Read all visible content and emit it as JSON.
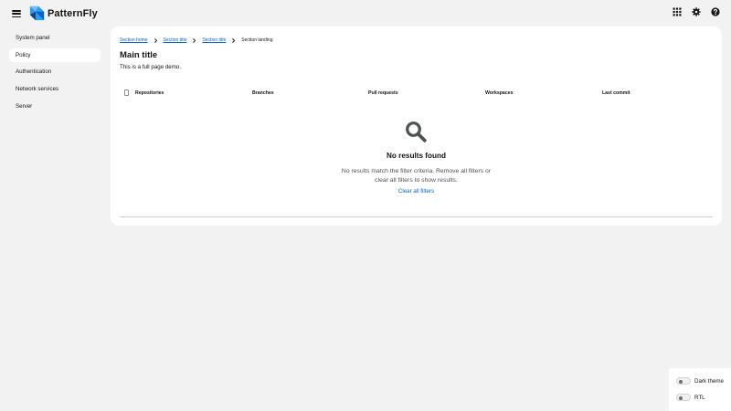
{
  "app": {
    "name": "PatternFly"
  },
  "masthead": {
    "icons": [
      "hamburger-menu-icon",
      "app-grid-icon",
      "gear-icon",
      "help-icon"
    ]
  },
  "sidebar": {
    "items": [
      {
        "label": "System panel",
        "active": false
      },
      {
        "label": "Policy",
        "active": true
      },
      {
        "label": "Authentication",
        "active": false
      },
      {
        "label": "Network services",
        "active": false
      },
      {
        "label": "Server",
        "active": false
      }
    ]
  },
  "breadcrumb": {
    "items": [
      {
        "label": "Section home",
        "link": true
      },
      {
        "label": "Section title",
        "link": true
      },
      {
        "label": "Section title",
        "link": true
      },
      {
        "label": "Section landing",
        "link": false
      }
    ]
  },
  "page": {
    "title": "Main title",
    "description": "This is a full page demo."
  },
  "table": {
    "columns": [
      "Repositories",
      "Branches",
      "Pull requests",
      "Workspaces",
      "Last commit"
    ]
  },
  "empty_state": {
    "icon": "search-icon",
    "title": "No results found",
    "body": "No results match the filter criteria. Remove all filters or clear all filters to show results.",
    "action": "Clear all filters"
  },
  "theme_panel": {
    "dark_theme_label": "Dark theme",
    "rtl_label": "RTL"
  },
  "colors": {
    "background": "#f2f2f2",
    "panel": "#ffffff",
    "link": "#0066cc",
    "text": "#151515",
    "muted": "#4f5255",
    "logo_blue": "#2b9af3"
  }
}
